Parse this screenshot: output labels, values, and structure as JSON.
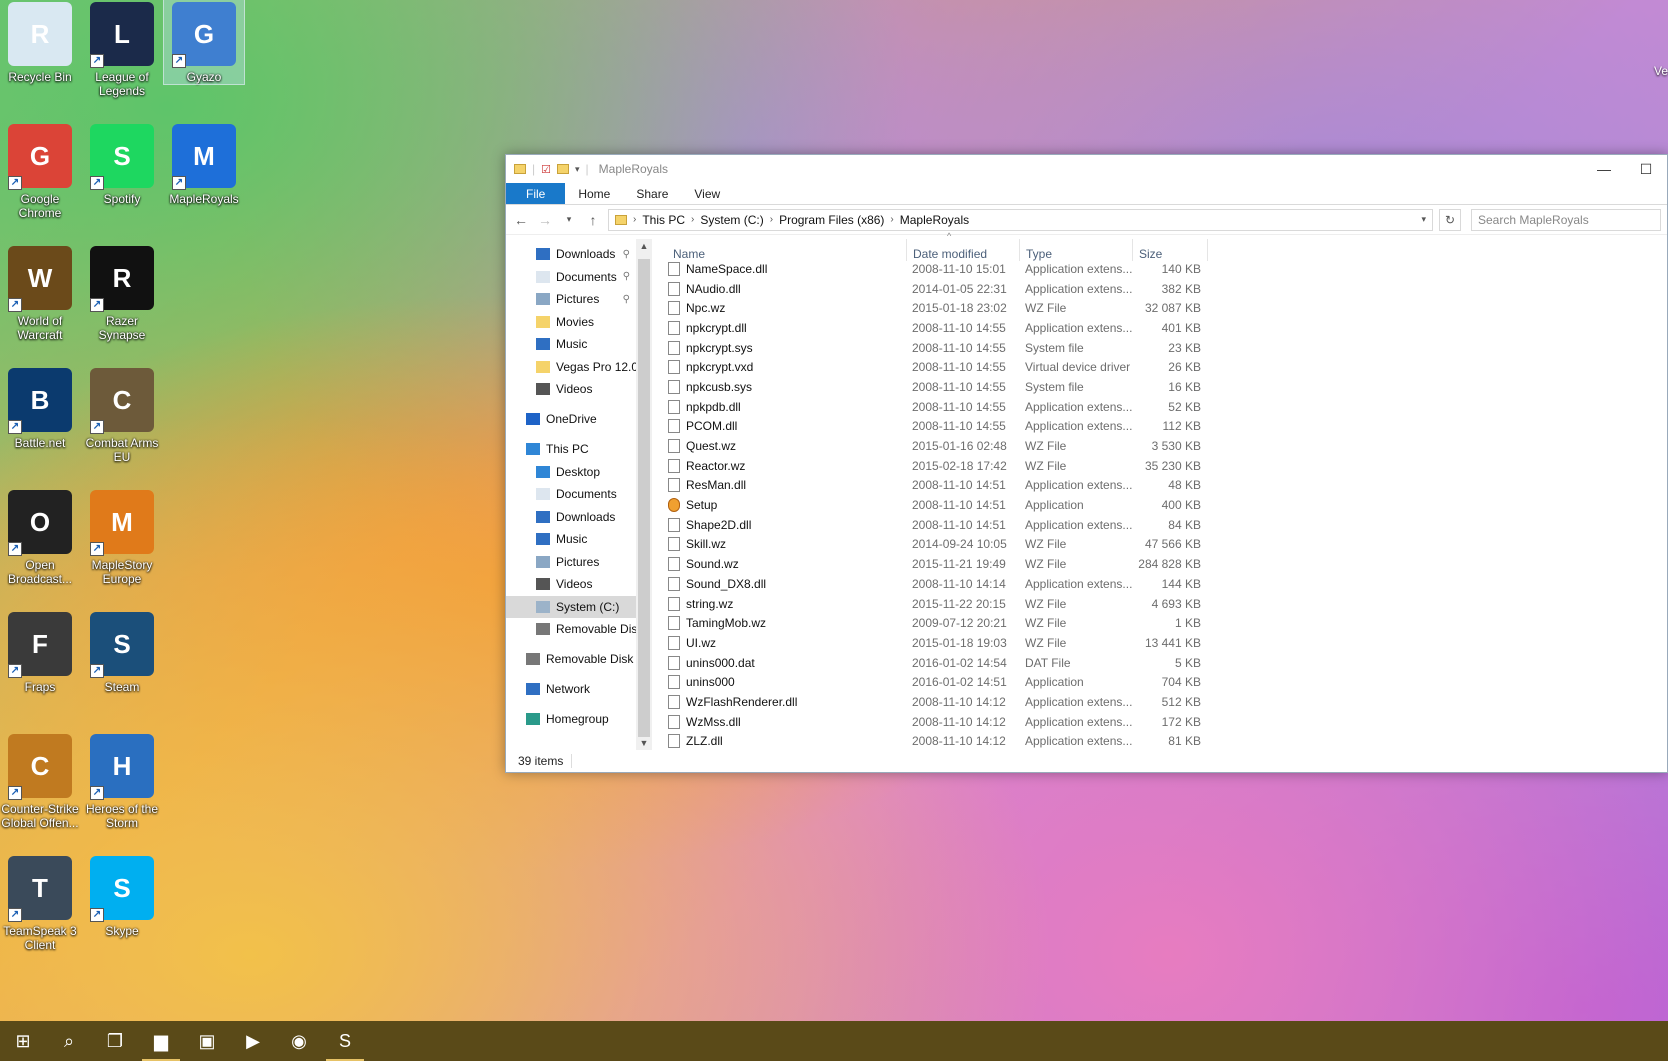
{
  "desktop": {
    "icons": [
      {
        "label": "Recycle Bin",
        "icon": "recycle-bin-icon",
        "color": "#d9e8f2"
      },
      {
        "label": "League of Legends",
        "icon": "league-of-legends-icon",
        "color": "#1b2a4a"
      },
      {
        "label": "Gyazo",
        "icon": "gyazo-icon",
        "color": "#3f7fd0"
      },
      {
        "label": "Google Chrome",
        "icon": "chrome-icon",
        "color": "#db4437"
      },
      {
        "label": "Spotify",
        "icon": "spotify-icon",
        "color": "#1ed760"
      },
      {
        "label": "MapleRoyals",
        "icon": "mapleroyals-icon",
        "color": "#1e6fd9"
      },
      {
        "label": "World of Warcraft",
        "icon": "world-of-warcraft-icon",
        "color": "#6b4a1a"
      },
      {
        "label": "Razer Synapse",
        "icon": "razer-synapse-icon",
        "color": "#111111"
      },
      {
        "label": "Battle.net",
        "icon": "battlenet-icon",
        "color": "#0b3a6e"
      },
      {
        "label": "Combat Arms EU",
        "icon": "combat-arms-icon",
        "color": "#6d5a3a"
      },
      {
        "label": "Open Broadcast...",
        "icon": "obs-icon",
        "color": "#222222"
      },
      {
        "label": "MapleStory Europe",
        "icon": "maplestory-icon",
        "color": "#e07a1a"
      },
      {
        "label": "Fraps",
        "icon": "fraps-icon",
        "color": "#3a3a3a"
      },
      {
        "label": "Steam",
        "icon": "steam-icon",
        "color": "#1b4f7a"
      },
      {
        "label": "Counter-Strike Global Offen...",
        "icon": "csgo-icon",
        "color": "#c07a20"
      },
      {
        "label": "Heroes of the Storm",
        "icon": "heroes-of-the-storm-icon",
        "color": "#2a6fc0"
      },
      {
        "label": "TeamSpeak 3 Client",
        "icon": "teamspeak-icon",
        "color": "#3a4a5a"
      },
      {
        "label": "Skype",
        "icon": "skype-icon",
        "color": "#00aff0"
      }
    ],
    "topright_fragment": "Ve"
  },
  "window": {
    "title": "MapleRoyals",
    "ribbon_tabs": [
      "File",
      "Home",
      "Share",
      "View"
    ],
    "breadcrumb": [
      "This PC",
      "System (C:)",
      "Program Files (x86)",
      "MapleRoyals"
    ],
    "search_placeholder": "Search MapleRoyals",
    "nav": [
      {
        "label": "Downloads",
        "level": 2,
        "pinned": true,
        "icon": "download-arrow-icon"
      },
      {
        "label": "Documents",
        "level": 2,
        "pinned": true,
        "icon": "document-icon"
      },
      {
        "label": "Pictures",
        "level": 2,
        "pinned": true,
        "icon": "pictures-icon"
      },
      {
        "label": "Movies",
        "level": 2,
        "pinned": false,
        "icon": "folder-icon"
      },
      {
        "label": "Music",
        "level": 2,
        "pinned": false,
        "icon": "music-note-icon"
      },
      {
        "label": "Vegas Pro 12.0",
        "level": 2,
        "pinned": false,
        "icon": "folder-icon"
      },
      {
        "label": "Videos",
        "level": 2,
        "pinned": false,
        "icon": "video-icon"
      },
      {
        "label": "OneDrive",
        "level": 1,
        "gap": true,
        "icon": "onedrive-cloud-icon"
      },
      {
        "label": "This PC",
        "level": 1,
        "gap": true,
        "icon": "computer-icon"
      },
      {
        "label": "Desktop",
        "level": 2,
        "icon": "desktop-icon"
      },
      {
        "label": "Documents",
        "level": 2,
        "icon": "document-icon"
      },
      {
        "label": "Downloads",
        "level": 2,
        "icon": "download-arrow-icon"
      },
      {
        "label": "Music",
        "level": 2,
        "icon": "music-note-icon"
      },
      {
        "label": "Pictures",
        "level": 2,
        "icon": "pictures-icon"
      },
      {
        "label": "Videos",
        "level": 2,
        "icon": "video-icon"
      },
      {
        "label": "System (C:)",
        "level": 2,
        "selected": true,
        "icon": "drive-icon"
      },
      {
        "label": "Removable Disk",
        "level": 2,
        "icon": "removable-disk-icon"
      },
      {
        "label": "Removable Disk (I",
        "level": 1,
        "gap": true,
        "icon": "removable-disk-icon"
      },
      {
        "label": "Network",
        "level": 1,
        "gap": true,
        "icon": "network-icon"
      },
      {
        "label": "Homegroup",
        "level": 1,
        "gap": true,
        "icon": "homegroup-icon"
      }
    ],
    "columns": {
      "name": "Name",
      "date": "Date modified",
      "type": "Type",
      "size": "Size"
    },
    "files": [
      {
        "name": "NameSpace.dll",
        "date": "2008-11-10 15:01",
        "type": "Application extens...",
        "size": "140 KB",
        "icon": "dll-file-icon"
      },
      {
        "name": "NAudio.dll",
        "date": "2014-01-05 22:31",
        "type": "Application extens...",
        "size": "382 KB",
        "icon": "dll-file-icon"
      },
      {
        "name": "Npc.wz",
        "date": "2015-01-18 23:02",
        "type": "WZ File",
        "size": "32 087 KB",
        "icon": "file-icon"
      },
      {
        "name": "npkcrypt.dll",
        "date": "2008-11-10 14:55",
        "type": "Application extens...",
        "size": "401 KB",
        "icon": "dll-file-icon"
      },
      {
        "name": "npkcrypt.sys",
        "date": "2008-11-10 14:55",
        "type": "System file",
        "size": "23 KB",
        "icon": "system-file-icon"
      },
      {
        "name": "npkcrypt.vxd",
        "date": "2008-11-10 14:55",
        "type": "Virtual device driver",
        "size": "26 KB",
        "icon": "system-file-icon"
      },
      {
        "name": "npkcusb.sys",
        "date": "2008-11-10 14:55",
        "type": "System file",
        "size": "16 KB",
        "icon": "system-file-icon"
      },
      {
        "name": "npkpdb.dll",
        "date": "2008-11-10 14:55",
        "type": "Application extens...",
        "size": "52 KB",
        "icon": "dll-file-icon"
      },
      {
        "name": "PCOM.dll",
        "date": "2008-11-10 14:55",
        "type": "Application extens...",
        "size": "112 KB",
        "icon": "dll-file-icon"
      },
      {
        "name": "Quest.wz",
        "date": "2015-01-16 02:48",
        "type": "WZ File",
        "size": "3 530 KB",
        "icon": "file-icon"
      },
      {
        "name": "Reactor.wz",
        "date": "2015-02-18 17:42",
        "type": "WZ File",
        "size": "35 230 KB",
        "icon": "file-icon"
      },
      {
        "name": "ResMan.dll",
        "date": "2008-11-10 14:51",
        "type": "Application extens...",
        "size": "48 KB",
        "icon": "dll-file-icon"
      },
      {
        "name": "Setup",
        "date": "2008-11-10 14:51",
        "type": "Application",
        "size": "400 KB",
        "icon": "setup-app-icon"
      },
      {
        "name": "Shape2D.dll",
        "date": "2008-11-10 14:51",
        "type": "Application extens...",
        "size": "84 KB",
        "icon": "dll-file-icon"
      },
      {
        "name": "Skill.wz",
        "date": "2014-09-24 10:05",
        "type": "WZ File",
        "size": "47 566 KB",
        "icon": "file-icon"
      },
      {
        "name": "Sound.wz",
        "date": "2015-11-21 19:49",
        "type": "WZ File",
        "size": "284 828 KB",
        "icon": "file-icon"
      },
      {
        "name": "Sound_DX8.dll",
        "date": "2008-11-10 14:14",
        "type": "Application extens...",
        "size": "144 KB",
        "icon": "dll-file-icon"
      },
      {
        "name": "string.wz",
        "date": "2015-11-22 20:15",
        "type": "WZ File",
        "size": "4 693 KB",
        "icon": "file-icon"
      },
      {
        "name": "TamingMob.wz",
        "date": "2009-07-12 20:21",
        "type": "WZ File",
        "size": "1 KB",
        "icon": "file-icon"
      },
      {
        "name": "UI.wz",
        "date": "2015-01-18 19:03",
        "type": "WZ File",
        "size": "13 441 KB",
        "icon": "file-icon"
      },
      {
        "name": "unins000.dat",
        "date": "2016-01-02 14:54",
        "type": "DAT File",
        "size": "5 KB",
        "icon": "file-icon"
      },
      {
        "name": "unins000",
        "date": "2016-01-02 14:51",
        "type": "Application",
        "size": "704 KB",
        "icon": "uninstaller-app-icon"
      },
      {
        "name": "WzFlashRenderer.dll",
        "date": "2008-11-10 14:12",
        "type": "Application extens...",
        "size": "512 KB",
        "icon": "dll-file-icon"
      },
      {
        "name": "WzMss.dll",
        "date": "2008-11-10 14:12",
        "type": "Application extens...",
        "size": "172 KB",
        "icon": "dll-file-icon"
      },
      {
        "name": "ZLZ.dll",
        "date": "2008-11-10 14:12",
        "type": "Application extens...",
        "size": "81 KB",
        "icon": "dll-file-icon"
      }
    ],
    "status_count": "39 items"
  },
  "taskbar": {
    "buttons": [
      {
        "name": "start-button",
        "icon": "windows-logo-icon",
        "glyph": "⊞"
      },
      {
        "name": "search-button",
        "icon": "search-icon",
        "glyph": "⌕"
      },
      {
        "name": "task-view-button",
        "icon": "task-view-icon",
        "glyph": "❐"
      },
      {
        "name": "file-explorer-button",
        "icon": "file-explorer-icon",
        "glyph": "▆",
        "active": true
      },
      {
        "name": "store-button",
        "icon": "store-icon",
        "glyph": "▣"
      },
      {
        "name": "media-player-button",
        "icon": "media-player-icon",
        "glyph": "▶"
      },
      {
        "name": "chrome-button",
        "icon": "chrome-icon",
        "glyph": "◉"
      },
      {
        "name": "skype-button",
        "icon": "skype-icon",
        "glyph": "S",
        "active": true
      }
    ],
    "colors": {
      "bar": "#5a4a18",
      "active_underline": "#e6c266"
    }
  }
}
